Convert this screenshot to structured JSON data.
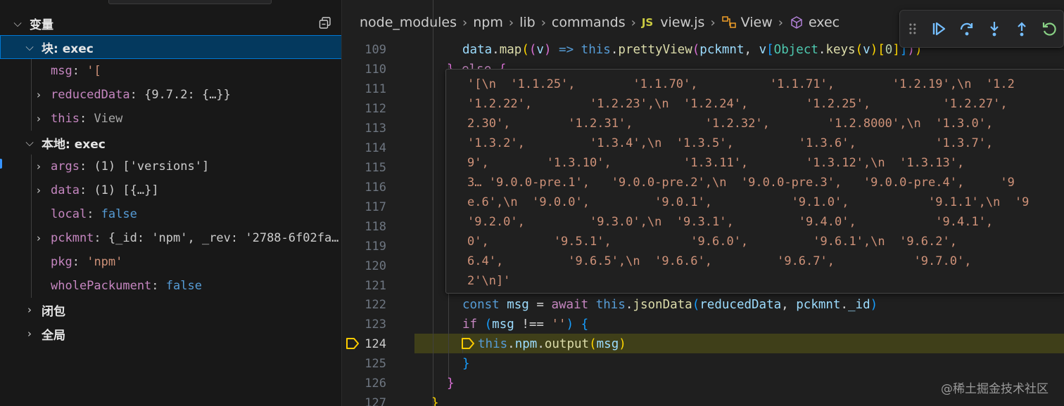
{
  "sidebar": {
    "title": "变量",
    "scopes": [
      {
        "label": "块: exec",
        "expanded": true,
        "selected": true,
        "vars": [
          {
            "name": "msg",
            "value": "'[",
            "value_kind": "string",
            "expandable": false
          },
          {
            "name": "reducedData",
            "value": "{9.7.2: {…}}",
            "value_kind": "object",
            "expandable": true
          },
          {
            "name": "this",
            "value": "View",
            "value_kind": "object",
            "expandable": true
          }
        ]
      },
      {
        "label": "本地: exec",
        "expanded": true,
        "selected": false,
        "vars": [
          {
            "name": "args",
            "value": "(1) ['versions']",
            "value_kind": "object",
            "expandable": true
          },
          {
            "name": "data",
            "value": "(1) [{…}]",
            "value_kind": "object",
            "expandable": true
          },
          {
            "name": "local",
            "value": "false",
            "value_kind": "boolean",
            "expandable": false
          },
          {
            "name": "pckmnt",
            "value": "{_id: 'npm', _rev: '2788-6f02fa…",
            "value_kind": "object",
            "expandable": true
          },
          {
            "name": "pkg",
            "value": "'npm'",
            "value_kind": "string",
            "expandable": false
          },
          {
            "name": "wholePackument",
            "value": "false",
            "value_kind": "boolean",
            "expandable": false
          }
        ]
      },
      {
        "label": "闭包",
        "expanded": false,
        "selected": false,
        "vars": []
      },
      {
        "label": "全局",
        "expanded": false,
        "selected": false,
        "vars": []
      }
    ]
  },
  "breadcrumb": {
    "items": [
      "node_modules",
      "npm",
      "lib",
      "commands",
      "view.js",
      "View",
      "exec"
    ],
    "js_badge": "JS"
  },
  "editor": {
    "line_numbers": [
      "109",
      "110",
      "111",
      "112",
      "113",
      "114",
      "115",
      "116",
      "117",
      "118",
      "119",
      "120",
      "121",
      "122",
      "123",
      "124",
      "125",
      "126",
      "127"
    ],
    "current_line": "124"
  },
  "hover": {
    "lines": [
      "'[\\n  '1.1.25',        '1.1.70',          '1.1.71',        '1.2.19',\\n  '1.2",
      "'1.2.22',        '1.2.23',\\n  '1.2.24',        '1.2.25',          '1.2.27',",
      "2.30',        '1.2.31',          '1.2.32',        '1.2.8000',\\n  '1.3.0',",
      "'1.3.2',         '1.3.4',\\n  '1.3.5',         '1.3.6',           '1.3.7',",
      "9',        '1.3.10',          '1.3.11',        '1.3.12',\\n  '1.3.13',",
      "3… '9.0.0-pre.1',   '9.0.0-pre.2',\\n  '9.0.0-pre.3',   '9.0.0-pre.4',     '9",
      "e.6',\\n  '9.0.0',         '9.0.1',           '9.1.0',           '9.1.1',\\n  '9",
      "'9.2.0',         '9.3.0',\\n  '9.3.1',         '9.4.0',           '9.4.1',",
      "0',         '9.5.1',           '9.6.0',         '9.6.1',\\n  '9.6.2',",
      "6.4',         '9.6.5',\\n  '9.6.6',         '9.6.7',           '9.7.0',",
      "2'\\n]'"
    ]
  },
  "code": {
    "l109": {
      "data": "data",
      "map": "map",
      "v": "v",
      "arrow": "=>",
      "this": "this",
      "fn": "prettyView",
      "arg1": "pckmnt",
      "arg2": "v",
      "obj": "Object",
      "keys": "keys",
      "v2": "v",
      "idx": "0"
    },
    "l110": {
      "close": "}",
      "else": "else",
      "open": "{"
    },
    "l122": {
      "const": "const",
      "msg": "msg",
      "eq": "=",
      "await": "await",
      "this": "this",
      "fn": "jsonData",
      "a1": "reducedData",
      "a2": "pckmnt",
      "prop": "_id"
    },
    "l123": {
      "if": "if",
      "msg": "msg",
      "op": "!==",
      "str": "''"
    },
    "l124": {
      "this": "this",
      "npm": "npm",
      "fn": "output",
      "msg": "msg"
    },
    "l125": {
      "close": "}"
    },
    "l126": {
      "close": "}"
    },
    "l127": {
      "close": "}"
    }
  },
  "watermark": "@稀土掘金技术社区",
  "colors": {
    "background": "#1f1f1f",
    "sidebar": "#181818",
    "selection": "#04395e",
    "current_line": "#4b4b18",
    "breakpoint": "#ffcc00",
    "continue": "#75beff",
    "restart": "#89d185"
  }
}
